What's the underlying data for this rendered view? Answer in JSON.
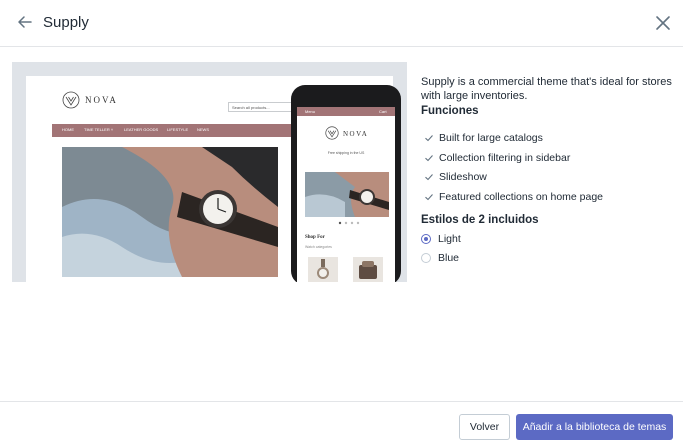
{
  "header": {
    "title": "Supply",
    "back_icon": "arrow-left-icon",
    "close_icon": "close-icon"
  },
  "preview": {
    "desktop": {
      "logo_text": "NOVA",
      "search_placeholder": "Search all products...",
      "nav_items": [
        "HOME",
        "TIME TELLER ˅",
        "LEATHER GOODS",
        "LIFESTYLE",
        "NEWS"
      ]
    },
    "mobile": {
      "menu_label": "Menu",
      "cart_label": "Cart",
      "logo_text": "NOVA",
      "tagline": "Free shipping in the US",
      "section_title": "Shop For",
      "section_sub": "Watch categories"
    }
  },
  "description": "Supply is a commercial theme that's ideal for stores with large inventories.",
  "features": {
    "title": "Funciones",
    "items": [
      "Built for large catalogs",
      "Collection filtering in sidebar",
      "Slideshow",
      "Featured collections on home page"
    ]
  },
  "styles": {
    "title": "Estilos de 2 incluidos",
    "options": [
      {
        "label": "Light",
        "selected": true
      },
      {
        "label": "Blue",
        "selected": false
      }
    ]
  },
  "footer": {
    "back_label": "Volver",
    "add_label": "Añadir a la biblioteca de temas"
  },
  "colors": {
    "accent": "#5c6ac4",
    "nav": "#a27476",
    "border": "#e3e5e8",
    "preview_bg": "#dfe3e8"
  }
}
